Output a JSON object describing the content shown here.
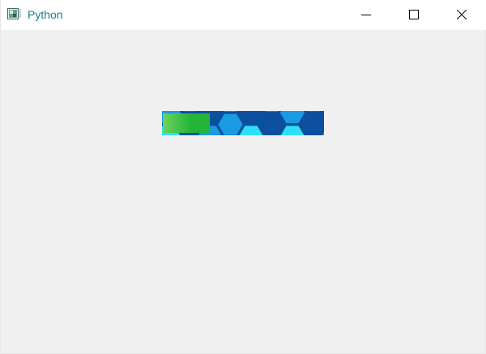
{
  "window": {
    "title": "Python",
    "icon": "python-app-icon",
    "controls": {
      "minimize_icon": "minimize-icon",
      "maximize_icon": "maximize-icon",
      "close_icon": "close-icon"
    }
  },
  "progress_bar": {
    "value_fraction": 0.3,
    "fill_color": "#22b53a",
    "track_color": "#0b4f9e",
    "hex_light_color": "#2ee0f5",
    "hex_mid_color": "#1a9ae0"
  }
}
